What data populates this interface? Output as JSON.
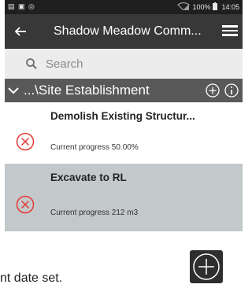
{
  "status_bar": {
    "left_icons": "▤ ▣ ◎",
    "signal": "▽",
    "battery_percent": "100%",
    "time": "14:05"
  },
  "app_bar": {
    "title": "Shadow Meadow Comm...",
    "back_icon": "arrow-left-icon",
    "menu_icon": "hamburger-menu-icon"
  },
  "search": {
    "placeholder": "Search",
    "value": ""
  },
  "group": {
    "title": "...\\Site Establishment"
  },
  "tasks": [
    {
      "name": "Demolish Existing Structur...",
      "progress": "Current progress 50.00%",
      "status_icon": "error-circle-x-icon"
    },
    {
      "name": "Excavate to RL",
      "progress": "Current progress 212 m3",
      "status_icon": "error-circle-x-icon"
    }
  ],
  "footer": {
    "text": "nt date set."
  },
  "colors": {
    "status_bar": "#1f1f1f",
    "app_bar": "#383838",
    "search_bg": "#ececec",
    "group_header": "#595959",
    "selected_row": "#c3c8cb",
    "error_red": "#e53935"
  }
}
